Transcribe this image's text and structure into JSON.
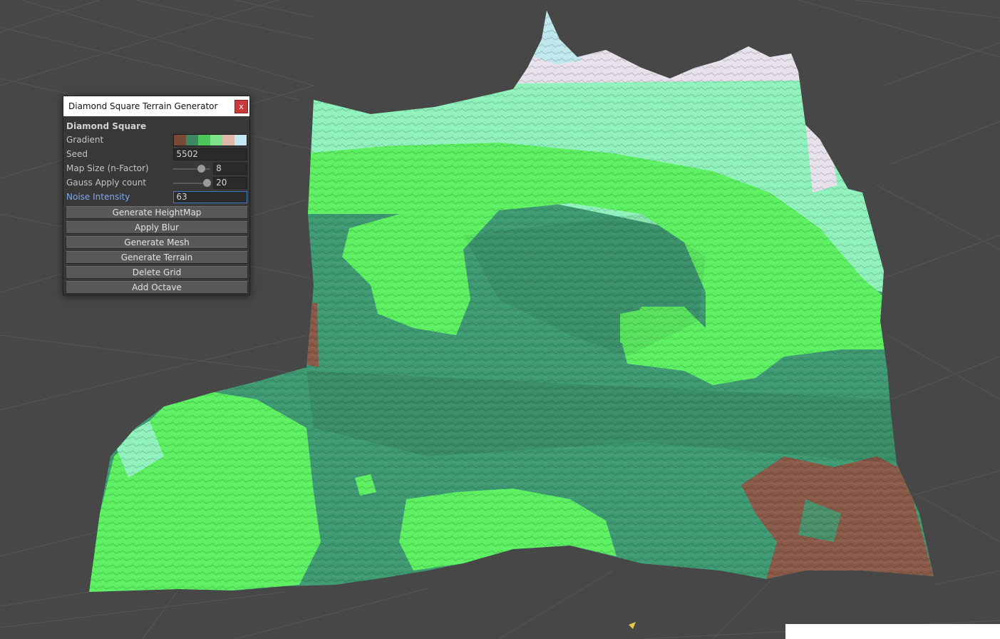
{
  "window": {
    "title": "Diamond Square Terrain Generator",
    "close_label": "x"
  },
  "section_title": "Diamond Square",
  "gradient": {
    "label": "Gradient",
    "stops": [
      "#7a4a38",
      "#3f8760",
      "#4ec75a",
      "#7fe38a",
      "#ddb8ab",
      "#c6e6f2"
    ]
  },
  "seed": {
    "label": "Seed",
    "value": "5502"
  },
  "map_size": {
    "label": "Map Size (n-Factor)",
    "value": "8",
    "slider_fraction": 0.74
  },
  "gauss": {
    "label": "Gauss Apply count",
    "value": "20",
    "slider_fraction": 0.9
  },
  "noise": {
    "label": "Noise Intensity",
    "value": "63"
  },
  "buttons": {
    "generate_heightmap": "Generate HeightMap",
    "apply_blur": "Apply Blur",
    "generate_mesh": "Generate Mesh",
    "generate_terrain": "Generate Terrain",
    "delete_grid": "Delete Grid",
    "add_octave": "Add Octave"
  },
  "colors": {
    "viewport_bg": "#474747",
    "terrain_snow": "#e6e1ea",
    "terrain_ice": "#bfe8ee",
    "terrain_mint": "#8ff2bc",
    "terrain_grass": "#5df062",
    "terrain_forest": "#3e9a72",
    "terrain_dirt": "#8a5a48",
    "accent_focus": "#3a79c4"
  }
}
